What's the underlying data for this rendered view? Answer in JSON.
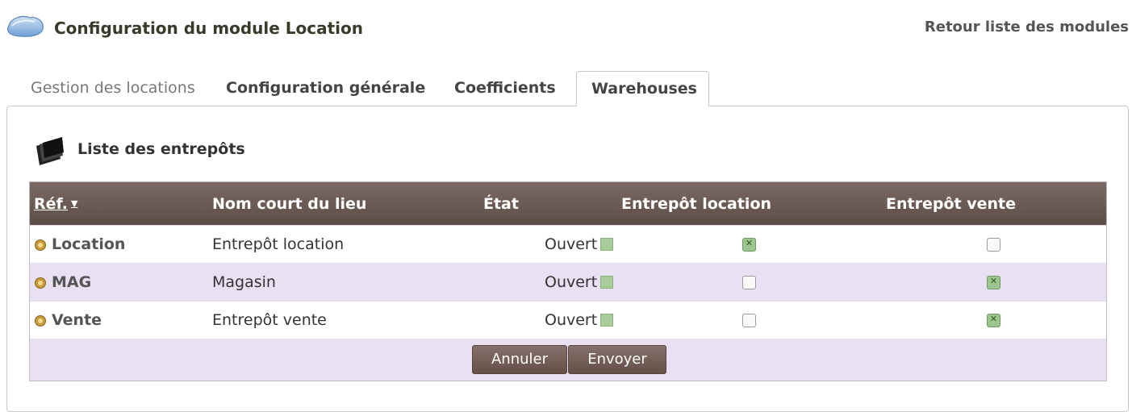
{
  "header": {
    "title": "Configuration du module Location",
    "back_link": "Retour liste des modules"
  },
  "tabs": [
    {
      "label": "Gestion des locations",
      "active": false
    },
    {
      "label": "Configuration générale",
      "active": false
    },
    {
      "label": "Coefficients",
      "active": false
    },
    {
      "label": "Warehouses",
      "active": true
    }
  ],
  "section": {
    "title": "Liste des entrepôts"
  },
  "table": {
    "columns": {
      "ref": "Réf.",
      "nom": "Nom court du lieu",
      "etat": "État",
      "loc": "Entrepôt location",
      "vente": "Entrepôt vente"
    },
    "rows": [
      {
        "ref": "Location",
        "nom": "Entrepôt location",
        "etat": "Ouvert",
        "loc": true,
        "vente": false
      },
      {
        "ref": "MAG",
        "nom": "Magasin",
        "etat": "Ouvert",
        "loc": false,
        "vente": true
      },
      {
        "ref": "Vente",
        "nom": "Entrepôt vente",
        "etat": "Ouvert",
        "loc": false,
        "vente": true
      }
    ]
  },
  "buttons": {
    "cancel": "Annuler",
    "send": "Envoyer"
  },
  "icons": {
    "module": "module-cloud-icon",
    "section": "folder-stack-icon",
    "warehouse": "warehouse-icon"
  },
  "colors": {
    "header_bg": "#6e5e58",
    "row_alt": "#e9e1f3",
    "status_open": "#a9cd9a"
  }
}
